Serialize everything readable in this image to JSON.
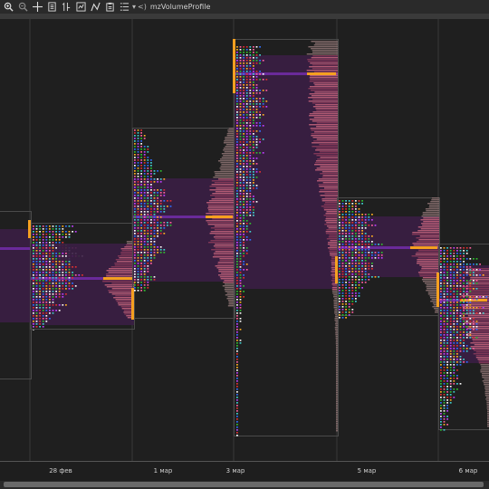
{
  "toolbar": {
    "buttons": [
      {
        "name": "zoom-in-icon"
      },
      {
        "name": "zoom-out-icon"
      },
      {
        "name": "crosshair-icon"
      },
      {
        "name": "document-icon"
      },
      {
        "name": "bar-settings-icon"
      },
      {
        "name": "auto-scale-icon"
      },
      {
        "name": "line-tool-icon"
      },
      {
        "name": "clipboard-icon"
      },
      {
        "name": "list-icon"
      }
    ],
    "dropdown_glyph": "▾",
    "indicator_prefix": "<)",
    "indicator_name": "mzVolumeProfile"
  },
  "axis": {
    "labels": [
      {
        "text": "28 фев"
      },
      {
        "text": "1 мар"
      },
      {
        "text": "3 мар"
      },
      {
        "text": "5 мар"
      },
      {
        "text": "6 мар"
      }
    ]
  },
  "colors": {
    "background": "#1f1f1f",
    "profile_fill": "#3a1e44",
    "poc_line": "#6a2a9a",
    "volume_bar": "#8a3a5a",
    "volume_bar_high": "#c0607a",
    "volume_bar_low": "#8a7070",
    "poc_marker": "#f5a020",
    "letters": [
      "#e03030",
      "#ffb020",
      "#30c030",
      "#3070ff",
      "#c040ff",
      "#ffffff",
      "#ff60a0",
      "#40d0d0"
    ]
  }
}
